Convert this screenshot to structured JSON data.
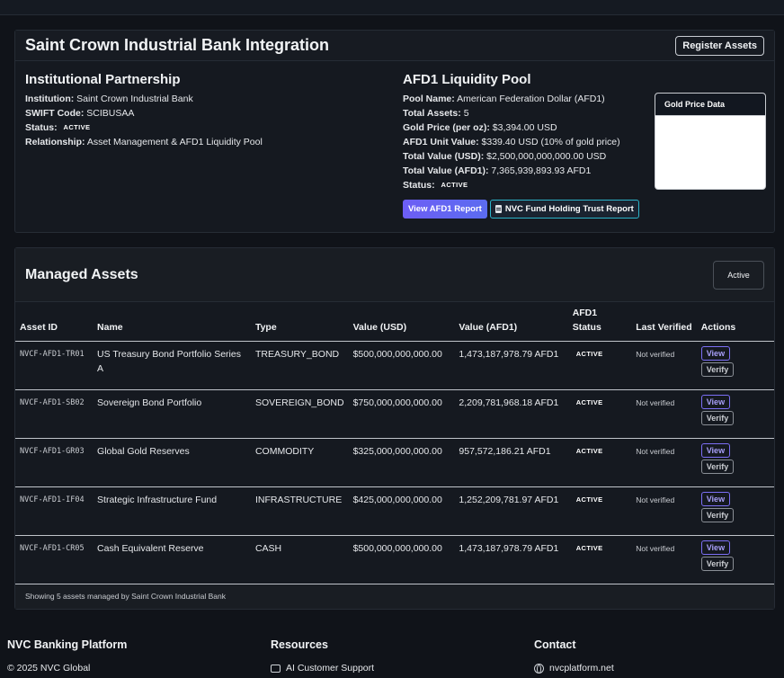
{
  "integration": {
    "title": "Saint Crown Industrial Bank Integration",
    "register_label": "Register Assets"
  },
  "partnership": {
    "title": "Institutional Partnership",
    "institution_label": "Institution:",
    "institution": "Saint Crown Industrial Bank",
    "swift_label": "SWIFT Code:",
    "swift": "SCIBUSAA",
    "status_label": "Status:",
    "status": "ACTIVE",
    "relationship_label": "Relationship:",
    "relationship": "Asset Management & AFD1 Liquidity Pool"
  },
  "pool": {
    "title": "AFD1 Liquidity Pool",
    "name_label": "Pool Name:",
    "name": "American Federation Dollar (AFD1)",
    "assets_label": "Total Assets:",
    "assets": "5",
    "gold_label": "Gold Price (per oz):",
    "gold": "$3,394.00 USD",
    "unit_label": "AFD1 Unit Value:",
    "unit": "$339.40 USD (10% of gold price)",
    "usd_label": "Total Value (USD):",
    "usd": "$2,500,000,000,000.00 USD",
    "afd1_label": "Total Value (AFD1):",
    "afd1": "7,365,939,893.93 AFD1",
    "status_label": "Status:",
    "status": "ACTIVE",
    "report_button": "View AFD1 Report",
    "trust_button": "NVC Fund Holding Trust Report",
    "gold_box_title": "Gold Price Data"
  },
  "assets": {
    "title": "Managed Assets",
    "filter_value": "Active",
    "columns": [
      "Asset ID",
      "Name",
      "Type",
      "Value (USD)",
      "Value (AFD1)",
      "AFD1 Status",
      "Last Verified",
      "Actions"
    ],
    "rows": [
      {
        "id": "NVCF-AFD1-TR01",
        "name": "US Treasury Bond Portfolio Series A",
        "type": "TREASURY_BOND",
        "usd": "$500,000,000,000.00",
        "afd1": "1,473,187,978.79 AFD1",
        "status": "ACTIVE",
        "verified": "Not verified"
      },
      {
        "id": "NVCF-AFD1-SB02",
        "name": "Sovereign Bond Portfolio",
        "type": "SOVEREIGN_BOND",
        "usd": "$750,000,000,000.00",
        "afd1": "2,209,781,968.18 AFD1",
        "status": "ACTIVE",
        "verified": "Not verified"
      },
      {
        "id": "NVCF-AFD1-GR03",
        "name": "Global Gold Reserves",
        "type": "COMMODITY",
        "usd": "$325,000,000,000.00",
        "afd1": "957,572,186.21 AFD1",
        "status": "ACTIVE",
        "verified": "Not verified"
      },
      {
        "id": "NVCF-AFD1-IF04",
        "name": "Strategic Infrastructure Fund",
        "type": "INFRASTRUCTURE",
        "usd": "$425,000,000,000.00",
        "afd1": "1,252,209,781.97 AFD1",
        "status": "ACTIVE",
        "verified": "Not verified"
      },
      {
        "id": "NVCF-AFD1-CR05",
        "name": "Cash Equivalent Reserve",
        "type": "CASH",
        "usd": "$500,000,000,000.00",
        "afd1": "1,473,187,978.79 AFD1",
        "status": "ACTIVE",
        "verified": "Not verified"
      }
    ],
    "view_label": "View",
    "verify_label": "Verify",
    "footer_text": "Showing 5 assets managed by Saint Crown Industrial Bank"
  },
  "footer": {
    "col1_title": "NVC Banking Platform",
    "col1_text": "© 2025 NVC Global",
    "col2_title": "Resources",
    "col2_text": "AI Customer Support",
    "col3_title": "Contact",
    "col3_text": "nvcplatform.net"
  },
  "icons": {
    "trust_report": "document-icon",
    "support": "robot-icon",
    "contact": "globe-icon"
  },
  "colors": {
    "background": "#101319",
    "card": "#151920",
    "accent_purple": "#6d5ef5",
    "accent_teal": "#2bb3c9"
  }
}
